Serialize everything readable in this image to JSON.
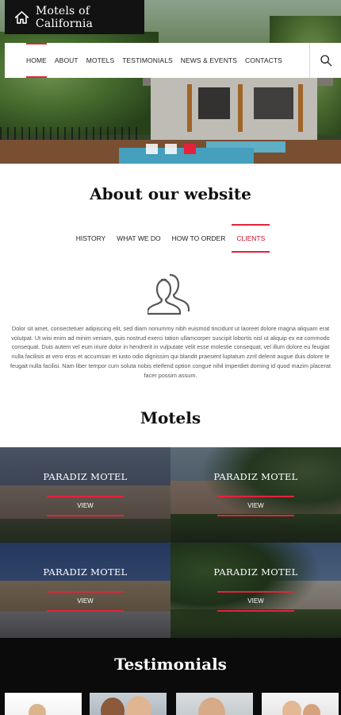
{
  "site": {
    "logo_text": "Motels of California"
  },
  "nav": {
    "items": [
      {
        "label": "Home",
        "active": true
      },
      {
        "label": "About"
      },
      {
        "label": "Motels"
      },
      {
        "label": "Testimonials"
      },
      {
        "label": "News & Events"
      },
      {
        "label": "Contacts"
      }
    ],
    "search_icon": "search-icon"
  },
  "hero": {
    "slides": 3,
    "active_slide": 3
  },
  "about": {
    "title": "About our website",
    "tabs": [
      {
        "label": "History"
      },
      {
        "label": "What we do"
      },
      {
        "label": "How to order"
      },
      {
        "label": "Clients",
        "active": true
      }
    ],
    "icon": "users-icon",
    "text": "Dolor sit amet, consectetuer adipiscing elit, sed diam nonummy nibh euismod tincidunt ut laoreet dolore magna aliquam erat volutpat. Ut wisi enim ad minim veniam, quis nostrud exerci tation ullamcorper suscipit lobortis nisl ut aliquip ex ea commodo consequat. Duis autem vel eum iriure dolor in hendrerit in vulputate velit esse molestie consequat, vel illum dolore eu feugiat nulla facilisis at vero eros et accumsan et iusto odio dignissim qui blandit praesent luptatum zzril delenit augue duis dolore te feugait nulla facilisi. Nam liber tempor cum soluta nobis eleifend option congue nihil imperdiet doming id quod mazim placerat facer possim assum."
  },
  "motels": {
    "title": "Motels",
    "items": [
      {
        "name": "PARADIZ MOTEL",
        "button": "VIEW"
      },
      {
        "name": "PARADIZ MOTEL",
        "button": "VIEW"
      },
      {
        "name": "PARADIZ MOTEL",
        "button": "VIEW"
      },
      {
        "name": "PARADIZ MOTEL",
        "button": "VIEW"
      }
    ]
  },
  "testimonials": {
    "title": "Testimonials"
  },
  "colors": {
    "accent": "#e4223b",
    "dark": "#121212"
  }
}
